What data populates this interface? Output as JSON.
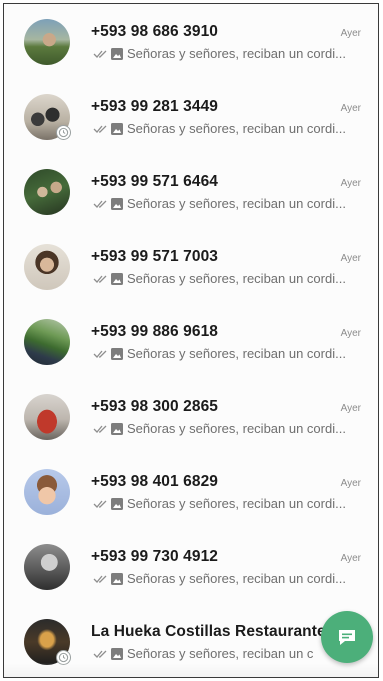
{
  "chats": [
    {
      "name": "+593 98 686 3910",
      "time": "Ayer",
      "preview": "Señoras y señores, reciban un cordi...",
      "status_ring": false
    },
    {
      "name": "+593 99 281 3449",
      "time": "Ayer",
      "preview": "Señoras y señores, reciban un cordi...",
      "status_ring": true
    },
    {
      "name": "+593 99 571 6464",
      "time": "Ayer",
      "preview": "Señoras y señores, reciban un cordi...",
      "status_ring": false
    },
    {
      "name": "+593 99 571 7003",
      "time": "Ayer",
      "preview": "Señoras y señores, reciban un cordi...",
      "status_ring": false
    },
    {
      "name": "+593 99 886 9618",
      "time": "Ayer",
      "preview": "Señoras y señores, reciban un cordi...",
      "status_ring": false
    },
    {
      "name": "+593 98 300 2865",
      "time": "Ayer",
      "preview": "Señoras y señores, reciban un cordi...",
      "status_ring": false
    },
    {
      "name": "+593 98 401 6829",
      "time": "Ayer",
      "preview": "Señoras y señores, reciban un cordi...",
      "status_ring": false
    },
    {
      "name": "+593 99 730 4912",
      "time": "Ayer",
      "preview": "Señoras y señores, reciban un cordi...",
      "status_ring": false
    },
    {
      "name": "La Hueka Costillas Restaurante",
      "time": "",
      "preview": "Señoras y señores, reciban un c",
      "status_ring": true
    }
  ],
  "icons": {
    "read_receipt": "double-check-icon",
    "message_type": "image-icon",
    "fab": "new-chat-icon"
  },
  "colors": {
    "accent": "#4caf7a",
    "name_text": "#1b1b1b",
    "preview_text": "#6f6f6f",
    "time_text": "#8c8c8c"
  }
}
